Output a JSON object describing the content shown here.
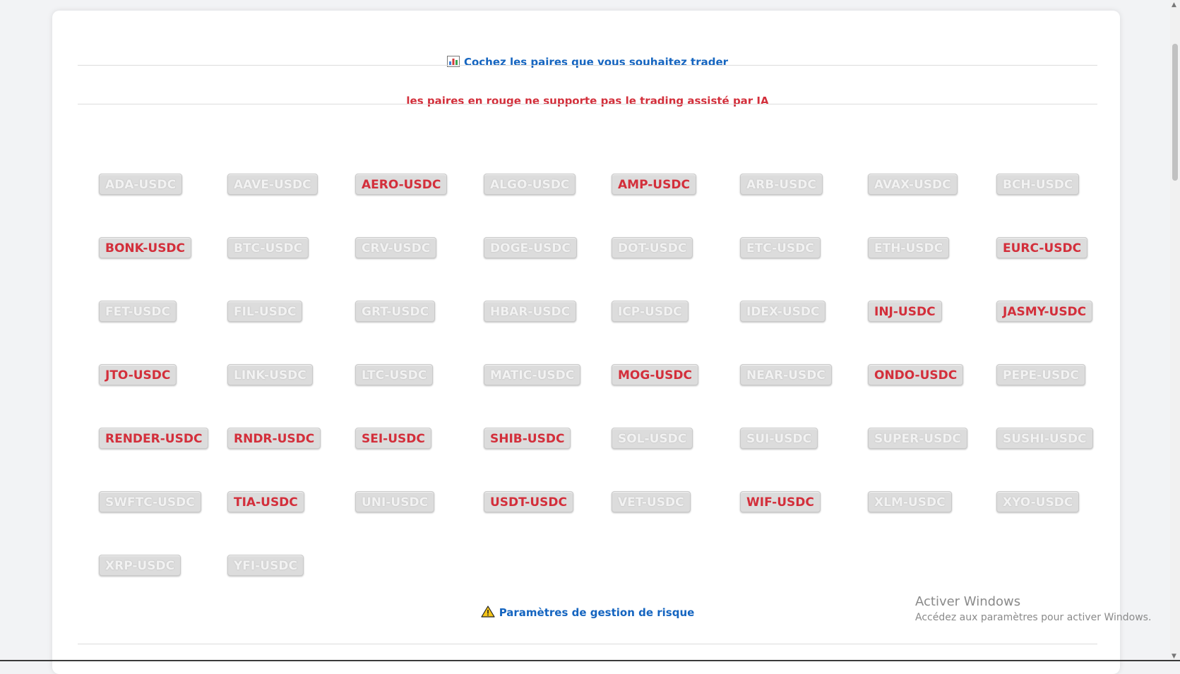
{
  "heading": {
    "icon": "bar-chart-icon",
    "text": "Cochez les paires que vous souhaitez trader"
  },
  "notice": {
    "text": "les paires en rouge ne supporte pas le trading assisté par IA"
  },
  "risk": {
    "icon": "warning-icon",
    "text": "Paramètres de gestion de risque"
  },
  "colors": {
    "accent_blue": "#1565c0",
    "unsupported_red": "#d32f3b",
    "chip_bg": "#dcdcdc"
  },
  "pairs": [
    {
      "label": "ADA-USDC",
      "unsupported": false
    },
    {
      "label": "AAVE-USDC",
      "unsupported": false
    },
    {
      "label": "AERO-USDC",
      "unsupported": true
    },
    {
      "label": "ALGO-USDC",
      "unsupported": false
    },
    {
      "label": "AMP-USDC",
      "unsupported": true
    },
    {
      "label": "ARB-USDC",
      "unsupported": false
    },
    {
      "label": "AVAX-USDC",
      "unsupported": false
    },
    {
      "label": "BCH-USDC",
      "unsupported": false
    },
    {
      "label": "BONK-USDC",
      "unsupported": true
    },
    {
      "label": "BTC-USDC",
      "unsupported": false
    },
    {
      "label": "CRV-USDC",
      "unsupported": false
    },
    {
      "label": "DOGE-USDC",
      "unsupported": false
    },
    {
      "label": "DOT-USDC",
      "unsupported": false
    },
    {
      "label": "ETC-USDC",
      "unsupported": false
    },
    {
      "label": "ETH-USDC",
      "unsupported": false
    },
    {
      "label": "EURC-USDC",
      "unsupported": true
    },
    {
      "label": "FET-USDC",
      "unsupported": false
    },
    {
      "label": "FIL-USDC",
      "unsupported": false
    },
    {
      "label": "GRT-USDC",
      "unsupported": false
    },
    {
      "label": "HBAR-USDC",
      "unsupported": false
    },
    {
      "label": "ICP-USDC",
      "unsupported": false
    },
    {
      "label": "IDEX-USDC",
      "unsupported": false
    },
    {
      "label": "INJ-USDC",
      "unsupported": true
    },
    {
      "label": "JASMY-USDC",
      "unsupported": true
    },
    {
      "label": "JTO-USDC",
      "unsupported": true
    },
    {
      "label": "LINK-USDC",
      "unsupported": false
    },
    {
      "label": "LTC-USDC",
      "unsupported": false
    },
    {
      "label": "MATIC-USDC",
      "unsupported": false
    },
    {
      "label": "MOG-USDC",
      "unsupported": true
    },
    {
      "label": "NEAR-USDC",
      "unsupported": false
    },
    {
      "label": "ONDO-USDC",
      "unsupported": true
    },
    {
      "label": "PEPE-USDC",
      "unsupported": false
    },
    {
      "label": "RENDER-USDC",
      "unsupported": true
    },
    {
      "label": "RNDR-USDC",
      "unsupported": true
    },
    {
      "label": "SEI-USDC",
      "unsupported": true
    },
    {
      "label": "SHIB-USDC",
      "unsupported": true
    },
    {
      "label": "SOL-USDC",
      "unsupported": false
    },
    {
      "label": "SUI-USDC",
      "unsupported": false
    },
    {
      "label": "SUPER-USDC",
      "unsupported": false
    },
    {
      "label": "SUSHI-USDC",
      "unsupported": false
    },
    {
      "label": "SWFTC-USDC",
      "unsupported": false
    },
    {
      "label": "TIA-USDC",
      "unsupported": true
    },
    {
      "label": "UNI-USDC",
      "unsupported": false
    },
    {
      "label": "USDT-USDC",
      "unsupported": true
    },
    {
      "label": "VET-USDC",
      "unsupported": false
    },
    {
      "label": "WIF-USDC",
      "unsupported": true
    },
    {
      "label": "XLM-USDC",
      "unsupported": false
    },
    {
      "label": "XYO-USDC",
      "unsupported": false
    },
    {
      "label": "XRP-USDC",
      "unsupported": false
    },
    {
      "label": "YFI-USDC",
      "unsupported": false
    }
  ],
  "watermark": {
    "title": "Activer Windows",
    "subtitle": "Accédez aux paramètres pour activer Windows."
  }
}
